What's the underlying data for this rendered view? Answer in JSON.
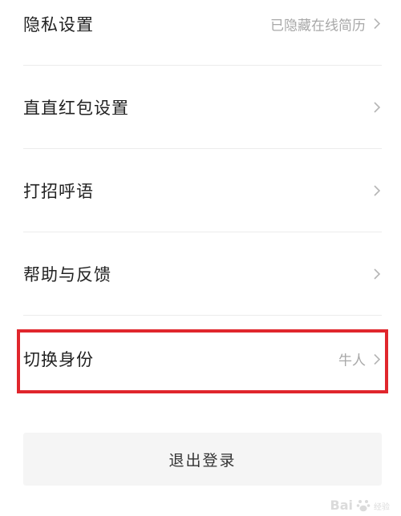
{
  "settings": {
    "items": [
      {
        "label": "隐私设置",
        "value": "已隐藏在线简历"
      },
      {
        "label": "直直红包设置",
        "value": ""
      },
      {
        "label": "打招呼语",
        "value": ""
      },
      {
        "label": "帮助与反馈",
        "value": ""
      },
      {
        "label": "切换身份",
        "value": "牛人"
      }
    ]
  },
  "logout": {
    "label": "退出登录"
  },
  "highlight": {
    "color": "#e0262c"
  },
  "watermark": {
    "brand": "Bai",
    "sub": "经验"
  },
  "icons": {
    "chevron": "chevron-right-icon"
  }
}
